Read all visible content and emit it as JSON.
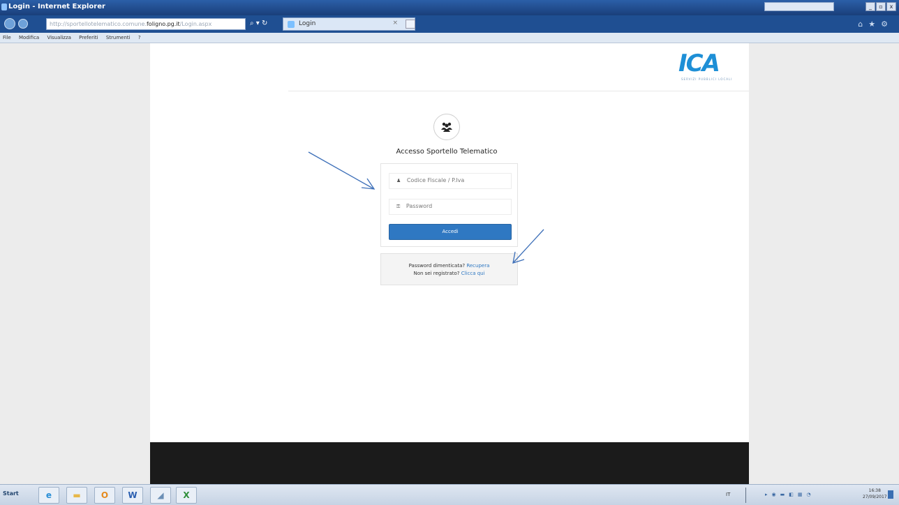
{
  "window": {
    "title": "Login - Internet Explorer",
    "search_placeholder": "Bing"
  },
  "addressbar": {
    "url_prefix": "http://sportellotelematico.comune.",
    "url_domain": "foligno.pg.it",
    "url_suffix": "/Login.aspx",
    "tab_label": "Login"
  },
  "menu": {
    "items": [
      "File",
      "Modifica",
      "Visualizza",
      "Preferiti",
      "Strumenti",
      "?"
    ]
  },
  "page": {
    "logo_text": "ICA",
    "logo_tagline": "SERVIZI PUBBLICI LOCALI",
    "login_title": "Accesso Sportello Telematico",
    "username_placeholder": "Codice Fiscale / P.Iva",
    "password_placeholder": "Password",
    "submit_label": "Accedi",
    "forgot_text": "Password dimenticata?",
    "forgot_link": "Recupera",
    "register_text": "Non sei registrato?",
    "register_link": "Clicca qui"
  },
  "taskbar": {
    "start_label": "Start",
    "apps": [
      "internet-explorer",
      "file-explorer",
      "outlook",
      "word",
      "printer",
      "excel"
    ],
    "language": "IT",
    "time": "16:38",
    "date": "27/09/2017"
  },
  "colors": {
    "accent": "#2f78c2",
    "logo": "#1e8fd6",
    "footer": "#1b1b1b",
    "annotation_arrow": "#3d6fb8"
  }
}
